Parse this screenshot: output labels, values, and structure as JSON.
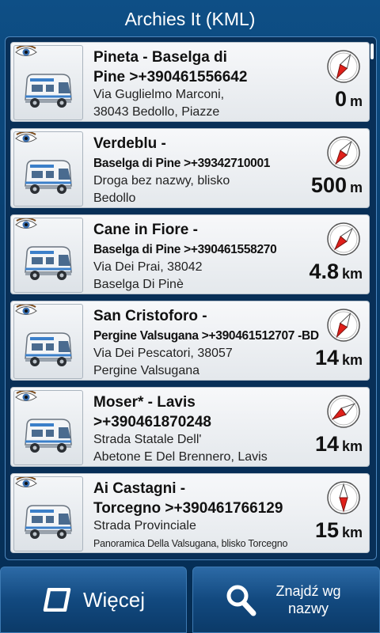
{
  "title": "Archies It (KML)",
  "items": [
    {
      "name_line1": "Pineta - Baselga di",
      "name_line2": "Pine >+390461556642",
      "addr_line1": "Via Guglielmo Marconi,",
      "addr_line2": "38043 Bedollo, Piazze",
      "distance": "0",
      "unit": "m",
      "compass_angle": 30
    },
    {
      "name_line1": "Verdeblu -",
      "name_line2": "Baselga di Pine >+39342710001",
      "addr_line1": "Droga bez nazwy, blisko",
      "addr_line2": "Bedollo",
      "distance": "500",
      "unit": "m",
      "compass_angle": 35
    },
    {
      "name_line1": "Cane in Fiore -",
      "name_line2": "Baselga di Pine >+390461558270",
      "addr_line1": "Via Dei Prai, 38042",
      "addr_line2": "Baselga Di Pinè",
      "distance": "4.8",
      "unit": "km",
      "compass_angle": 40
    },
    {
      "name_line1": "San Cristoforo -",
      "name_line2": "Pergine Valsugana >+390461512707 -BD",
      "addr_line1": "Via Dei Pescatori, 38057",
      "addr_line2": "Pergine Valsugana",
      "distance": "14",
      "unit": "km",
      "compass_angle": 30
    },
    {
      "name_line1": "Moser* - Lavis",
      "name_line2": ">+390461870248",
      "addr_line1": "Strada Statale Dell'",
      "addr_line2": "Abetone E Del Brennero, Lavis",
      "distance": "14",
      "unit": "km",
      "compass_angle": 55
    },
    {
      "name_line1": "Ai Castagni -",
      "name_line2": "Torcegno >+390461766129",
      "addr_line1": "Strada Provinciale",
      "addr_line2": "Panoramica Della Valsugana, blisko Torcegno",
      "distance": "15",
      "unit": "km",
      "compass_angle": 0
    }
  ],
  "buttons": {
    "more_label": "Więcej",
    "find_label": "Znajdź wg nazwy"
  },
  "colors": {
    "compass_needle": "#e0201a",
    "background": "#0b3f70"
  }
}
